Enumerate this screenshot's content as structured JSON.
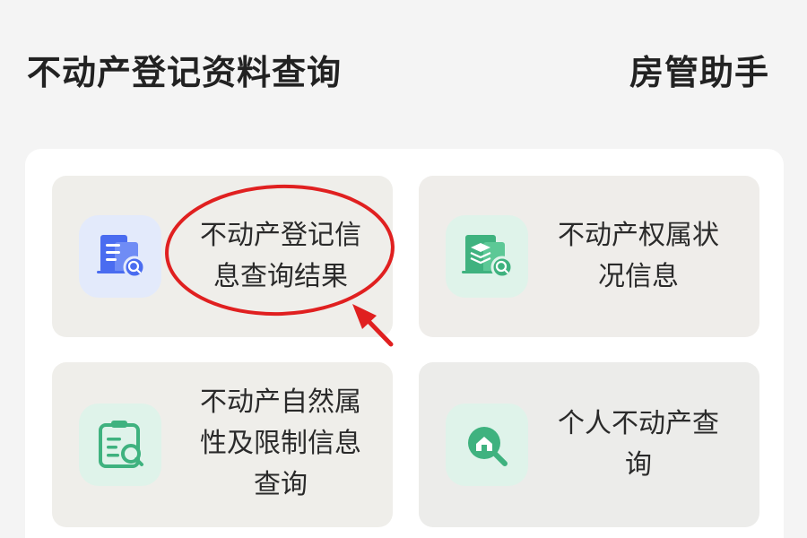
{
  "header": {
    "title": "不动产登记资料查询",
    "brand": "房管助手"
  },
  "cards": [
    {
      "line1": "不动产登记信",
      "line2": "息查询结果",
      "icon": "building-document-search-icon",
      "accent": "#4a6cf0",
      "tile_bg": "#e3eafb"
    },
    {
      "line1": "不动产权属状",
      "line2": "况信息",
      "icon": "layers-document-search-icon",
      "accent": "#3fb27f",
      "tile_bg": "#dff3ea"
    },
    {
      "line1": "不动产自然属",
      "line2": "性及限制信息",
      "line3": "查询",
      "icon": "clipboard-search-icon",
      "accent": "#3fb27f",
      "tile_bg": "#dff3ea"
    },
    {
      "line1": "个人不动产查",
      "line2": "询",
      "icon": "house-search-icon",
      "accent": "#3fb27f",
      "tile_bg": "#dff3ea"
    }
  ],
  "annotation": {
    "color": "#e02020"
  }
}
